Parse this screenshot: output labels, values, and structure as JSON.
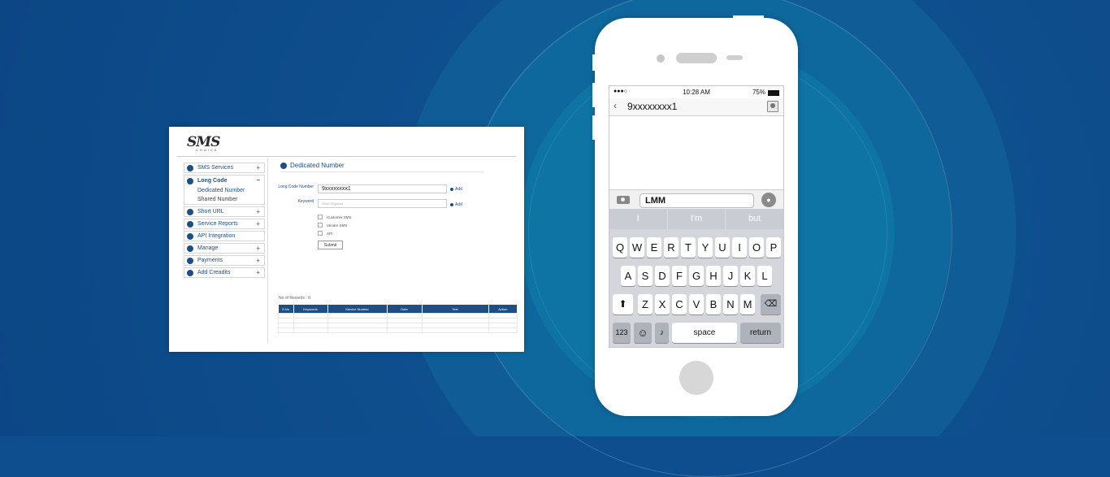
{
  "web": {
    "logo": "SMS",
    "logo_sub": "CHOICE",
    "nav": [
      {
        "label": "SMS Services",
        "toggle": "+"
      },
      {
        "label": "Long Code",
        "toggle": "−"
      },
      {
        "label": "Short URL",
        "toggle": "+"
      },
      {
        "label": "Service Reports",
        "toggle": "+"
      },
      {
        "label": "API Integration",
        "toggle": ""
      },
      {
        "label": "Manage",
        "toggle": "+"
      },
      {
        "label": "Payments",
        "toggle": "+"
      },
      {
        "label": "Add Creadits",
        "toggle": "+"
      }
    ],
    "long_code_sub": [
      "Dedicated Number",
      "Shared Number"
    ],
    "section_title": "Dedicated Number",
    "form": {
      "long_code_label": "Long Code Number",
      "long_code_value": "9xxxxxxxx1",
      "keyword_label": "Keyword",
      "keyword_placeholder": "Short Keyword",
      "add_label": "Add",
      "checkboxes": [
        "Customer SMS",
        "Vendor SMS",
        "API"
      ],
      "submit": "Submit"
    },
    "records_label": "No of Records : 0",
    "table_headers": [
      "S.No",
      "Keywords",
      "Service Number",
      "Date",
      "Text",
      "Action"
    ]
  },
  "phone": {
    "signal": "●●●○",
    "time": "10:28 AM",
    "battery": "75%",
    "contact": "9xxxxxxxx1",
    "message_text": "LMM",
    "suggestions": [
      "I",
      "I'm",
      "but"
    ],
    "row1": [
      "Q",
      "W",
      "E",
      "R",
      "T",
      "Y",
      "U",
      "I",
      "O",
      "P"
    ],
    "row2": [
      "A",
      "S",
      "D",
      "F",
      "G",
      "H",
      "J",
      "K",
      "L"
    ],
    "row3": [
      "Z",
      "X",
      "C",
      "V",
      "B",
      "N",
      "M"
    ],
    "key_123": "123",
    "key_space": "space",
    "key_return": "return"
  }
}
